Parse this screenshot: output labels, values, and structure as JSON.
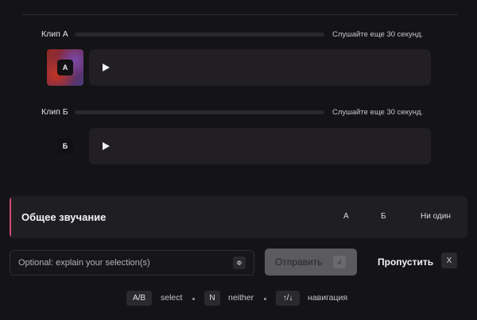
{
  "clips": [
    {
      "label": "Клип A",
      "status": "Слушайте еще 30 секунд.",
      "progress": 0,
      "badge": "A",
      "thumbnail_colors": [
        "#9b2a1f",
        "#6a2c5e",
        "#4a3a7a"
      ]
    },
    {
      "label": "Клип Б",
      "status": "Слушайте еще 30 секунд.",
      "progress": 0,
      "badge": "Б",
      "thumbnail_colors": [
        "#141315"
      ]
    }
  ],
  "question": {
    "title": "Общее звучание",
    "accent_color": "#d44a76",
    "options": [
      "A",
      "Б",
      "Ни один"
    ]
  },
  "explain": {
    "placeholder": "Optional: explain your selection(s)",
    "shortcut": "Ф"
  },
  "submit": {
    "label": "Отправить",
    "shortcut": "↲"
  },
  "skip": {
    "label": "Пропустить",
    "shortcut": "X"
  },
  "hints": {
    "ab_key": "A/B",
    "ab_text": "select",
    "n_key": "N",
    "n_text": "neither",
    "nav_key": "↑/↓",
    "nav_text": "навигация"
  },
  "icons": {
    "play": "play-icon",
    "enter": "enter-key-icon"
  }
}
